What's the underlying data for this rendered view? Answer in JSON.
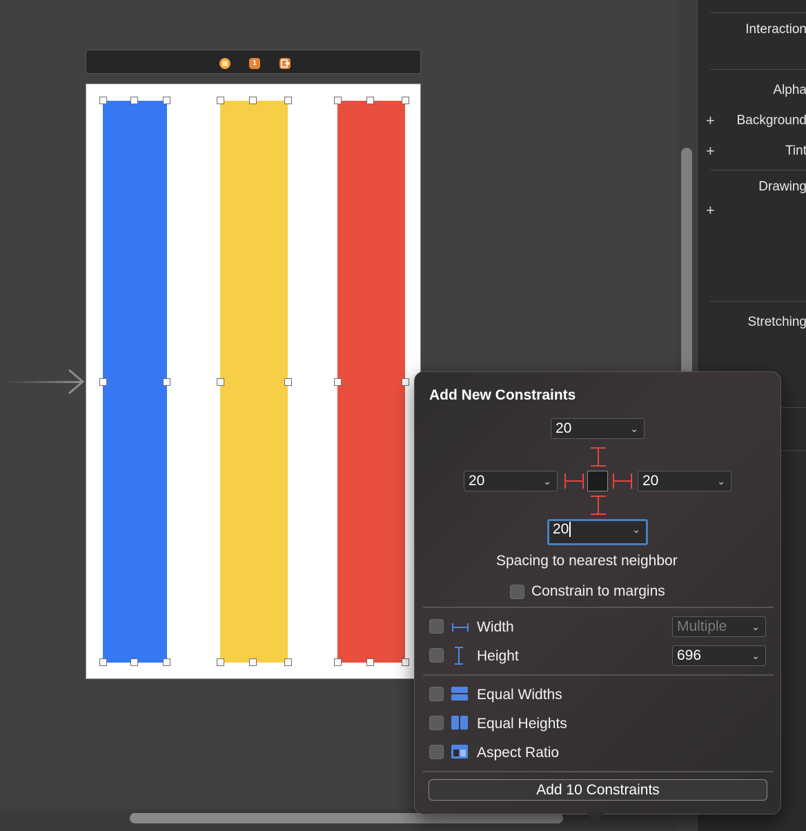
{
  "inspector": {
    "interaction_label": "Interaction",
    "alpha_label": "Alpha",
    "background_label": "Background",
    "tint_label": "Tint",
    "drawing_label": "Drawing",
    "stretching_label": "Stretching"
  },
  "scene": {
    "icons": [
      "view-controller-icon",
      "first-responder-icon",
      "exit-icon"
    ],
    "first_responder_badge": "1",
    "stripe_colors": [
      "#3677f2",
      "#f6cf47",
      "#e94f3e"
    ]
  },
  "popover": {
    "title": "Add New Constraints",
    "top_spacing": "20",
    "left_spacing": "20",
    "right_spacing": "20",
    "bottom_spacing": "20",
    "spacing_caption": "Spacing to nearest neighbor",
    "constrain_margins_label": "Constrain to margins",
    "width_label": "Width",
    "width_value": "Multiple",
    "height_label": "Height",
    "height_value": "696",
    "equal_widths_label": "Equal Widths",
    "equal_heights_label": "Equal Heights",
    "aspect_ratio_label": "Aspect Ratio",
    "add_button_label": "Add 10 Constraints",
    "accent_color": "#4a7fbf",
    "strut_color": "#e0483b"
  }
}
